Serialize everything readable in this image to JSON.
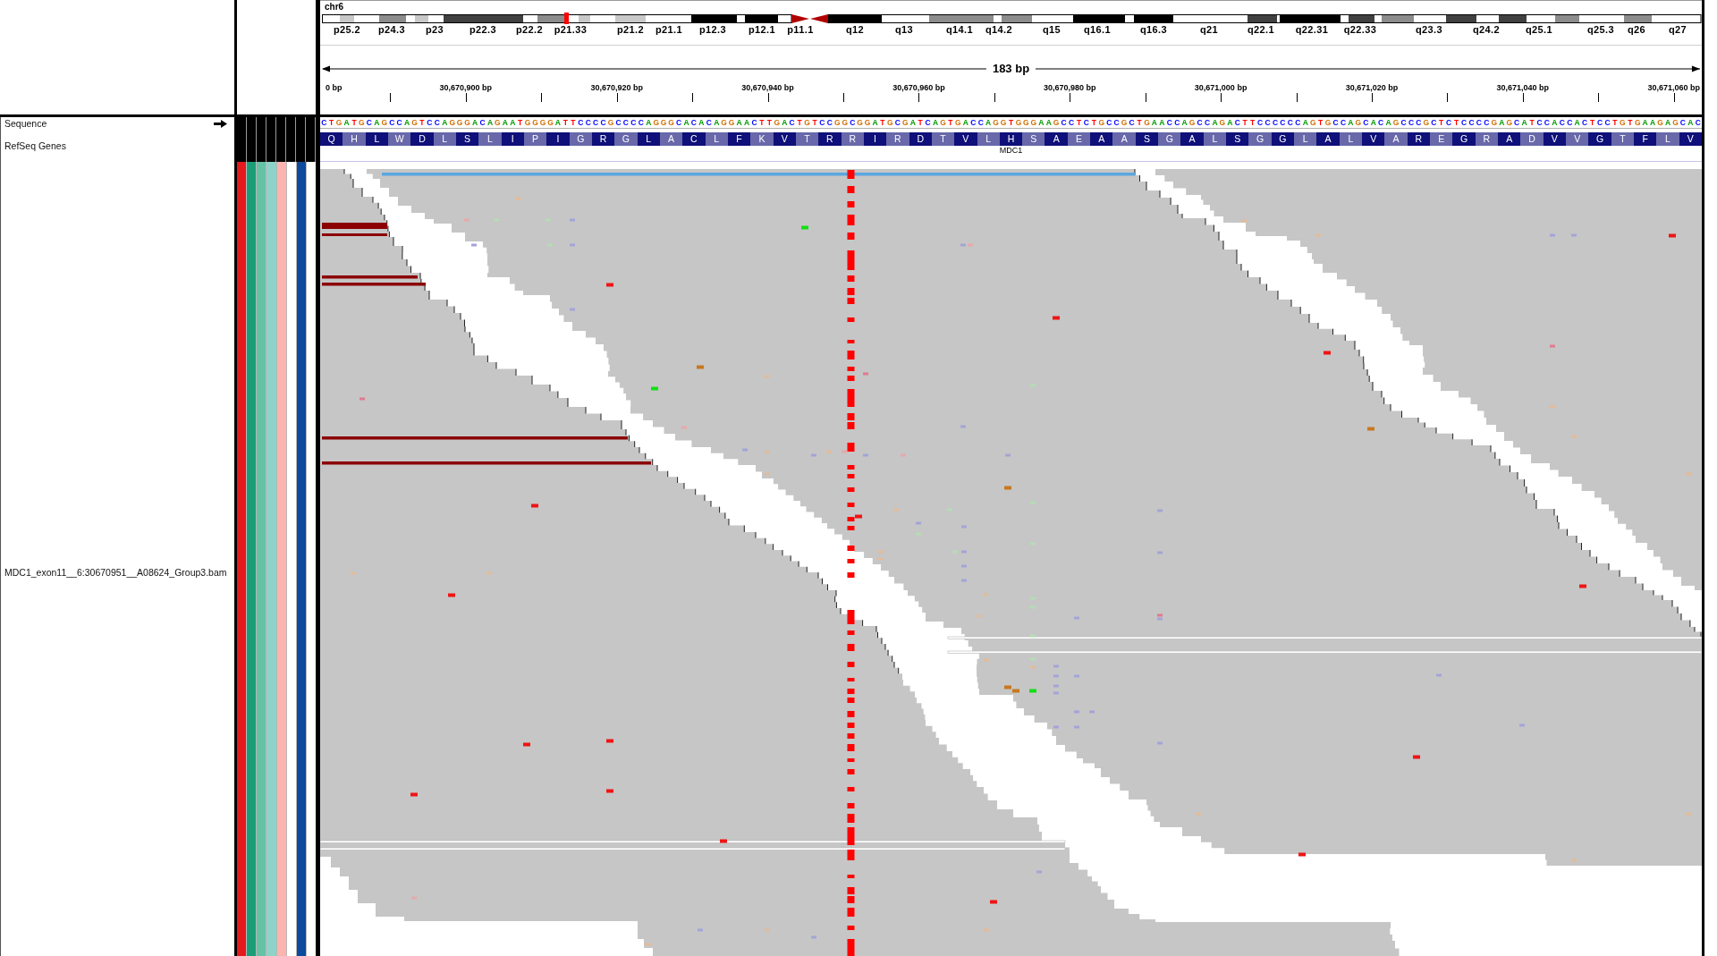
{
  "ideogram": {
    "chromosome": "chr6",
    "bands": [
      {
        "label": "p25.2"
      },
      {
        "label": "p24.3"
      },
      {
        "label": "p23"
      },
      {
        "label": "p22.3"
      },
      {
        "label": "p22.2"
      },
      {
        "label": "p21.33"
      },
      {
        "label": "p21.2"
      },
      {
        "label": "p21.1"
      },
      {
        "label": "p12.3"
      },
      {
        "label": "p12.1"
      },
      {
        "label": "p11.1"
      },
      {
        "label": "q12"
      },
      {
        "label": "q13"
      },
      {
        "label": "q14.1"
      },
      {
        "label": "q14.2"
      },
      {
        "label": "q15"
      },
      {
        "label": "q16.1"
      },
      {
        "label": "q16.3"
      },
      {
        "label": "q21"
      },
      {
        "label": "q22.1"
      },
      {
        "label": "q22.31"
      },
      {
        "label": "q22.33"
      },
      {
        "label": "q23.3"
      },
      {
        "label": "q24.2"
      },
      {
        "label": "q25.1"
      },
      {
        "label": "q25.3"
      },
      {
        "label": "q26"
      },
      {
        "label": "q27"
      }
    ]
  },
  "ruler": {
    "span": "183 bp",
    "ticks": [
      "0 bp",
      "30,670,900 bp",
      "30,670,920 bp",
      "30,670,940 bp",
      "30,670,960 bp",
      "30,670,980 bp",
      "30,671,000 bp",
      "30,671,020 bp",
      "30,671,040 bp",
      "30,671,060 bp"
    ]
  },
  "tracks": [
    {
      "kind": "sequence",
      "name": "Sequence",
      "bases": [
        "C",
        "T",
        "G",
        "A",
        "T",
        "G",
        "C",
        "A",
        "G",
        "C",
        "C",
        "A",
        "G",
        "T",
        "C",
        "C",
        "A",
        "G",
        "G",
        "G",
        "A",
        "C",
        "A",
        "G",
        "A",
        "A",
        "T",
        "G",
        "G",
        "G",
        "G",
        "A",
        "T",
        "T",
        "C",
        "C",
        "C",
        "C",
        "G",
        "C",
        "C",
        "C",
        "C",
        "A",
        "G",
        "G",
        "G",
        "C",
        "A",
        "C",
        "A",
        "C",
        "A",
        "G",
        "G",
        "A",
        "A",
        "C",
        "T",
        "T",
        "G",
        "A",
        "C",
        "T",
        "G",
        "T",
        "C",
        "C",
        "G",
        "G",
        "C",
        "G",
        "G",
        "A",
        "T",
        "G",
        "C",
        "G",
        "A",
        "T",
        "C",
        "A",
        "G",
        "T",
        "G",
        "A",
        "C",
        "C",
        "A",
        "G",
        "G",
        "T",
        "G",
        "G",
        "G",
        "A",
        "A",
        "G",
        "C",
        "C",
        "T",
        "C",
        "T",
        "G",
        "C",
        "C",
        "G",
        "C",
        "T",
        "G",
        "A",
        "A",
        "C",
        "C",
        "A",
        "G",
        "C",
        "C",
        "A",
        "G",
        "A",
        "C",
        "T",
        "T",
        "C",
        "C",
        "C",
        "C",
        "C",
        "C",
        "A",
        "G",
        "T",
        "G",
        "C",
        "C",
        "A",
        "G",
        "C",
        "A",
        "C",
        "A",
        "G",
        "C",
        "C",
        "C",
        "G",
        "C",
        "T",
        "C",
        "T",
        "C",
        "C",
        "C",
        "C",
        "G",
        "A",
        "G",
        "C",
        "A",
        "T",
        "C",
        "C",
        "A",
        "C",
        "C",
        "A",
        "C",
        "T",
        "C",
        "C",
        "T",
        "G",
        "T",
        "G",
        "A",
        "A",
        "G",
        "A",
        "G",
        "C",
        "A",
        "C"
      ]
    },
    {
      "kind": "genes",
      "name": "RefSeq Genes",
      "gene": "MDC1",
      "amino_acids": [
        "Q",
        "H",
        "L",
        "W",
        "D",
        "L",
        "S",
        "L",
        "I",
        "P",
        "I",
        "G",
        "R",
        "G",
        "L",
        "A",
        "C",
        "L",
        "F",
        "K",
        "V",
        "T",
        "R",
        "R",
        "I",
        "R",
        "D",
        "T",
        "V",
        "L",
        "H",
        "S",
        "A",
        "E",
        "A",
        "A",
        "S",
        "G",
        "A",
        "L",
        "S",
        "G",
        "G",
        "L",
        "A",
        "L",
        "V",
        "A",
        "R",
        "E",
        "G",
        "R",
        "A",
        "D",
        "V",
        "V",
        "G",
        "T",
        "F",
        "L",
        "V"
      ]
    },
    {
      "kind": "alignment",
      "name": "MDC1_exon11__6:30670951__A08624_Group3.bam"
    }
  ],
  "attributes": [
    {
      "color": "#e41a1c"
    },
    {
      "color": "#1b9e77"
    },
    {
      "color": "#66c2a5"
    },
    {
      "color": "#8dd3c7"
    },
    {
      "color": "#fbb4ae"
    },
    {
      "color": "#ffffff"
    },
    {
      "color": "#0b4a9c"
    },
    {
      "color": "#ffffff"
    }
  ]
}
